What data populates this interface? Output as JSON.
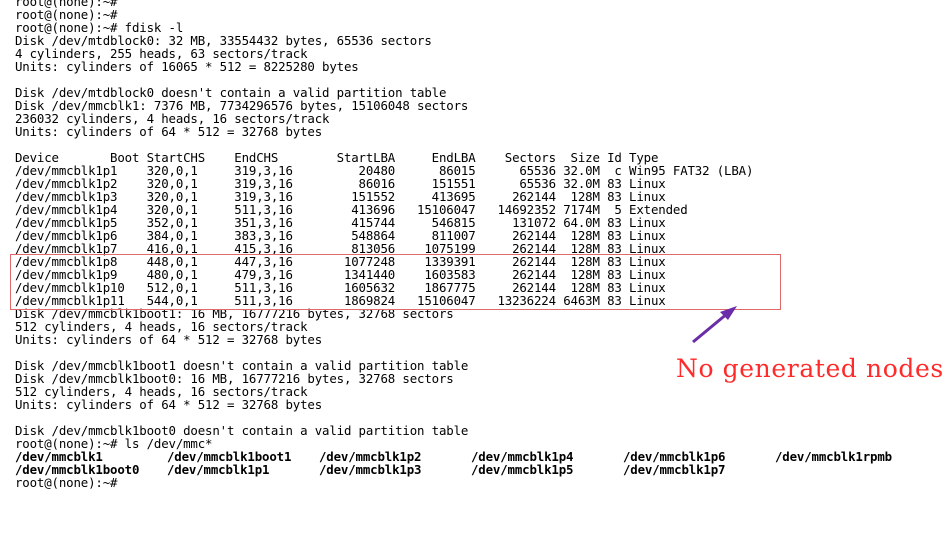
{
  "terminal": {
    "lines": [
      "root@(none):~#",
      "root@(none):~#",
      "root@(none):~# fdisk -l",
      "Disk /dev/mtdblock0: 32 MB, 33554432 bytes, 65536 sectors",
      "4 cylinders, 255 heads, 63 sectors/track",
      "Units: cylinders of 16065 * 512 = 8225280 bytes",
      "",
      "Disk /dev/mtdblock0 doesn't contain a valid partition table",
      "Disk /dev/mmcblk1: 7376 MB, 7734296576 bytes, 15106048 sectors",
      "236032 cylinders, 4 heads, 16 sectors/track",
      "Units: cylinders of 64 * 512 = 32768 bytes",
      "",
      "Device       Boot StartCHS    EndCHS        StartLBA     EndLBA    Sectors  Size Id Type",
      "/dev/mmcblk1p1    320,0,1     319,3,16         20480      86015      65536 32.0M  c Win95 FAT32 (LBA)",
      "/dev/mmcblk1p2    320,0,1     319,3,16         86016     151551      65536 32.0M 83 Linux",
      "/dev/mmcblk1p3    320,0,1     319,3,16        151552     413695     262144  128M 83 Linux",
      "/dev/mmcblk1p4    320,0,1     511,3,16        413696   15106047   14692352 7174M  5 Extended",
      "/dev/mmcblk1p5    352,0,1     351,3,16        415744     546815     131072 64.0M 83 Linux",
      "/dev/mmcblk1p6    384,0,1     383,3,16        548864     811007     262144  128M 83 Linux",
      "/dev/mmcblk1p7    416,0,1     415,3,16        813056    1075199     262144  128M 83 Linux",
      "/dev/mmcblk1p8    448,0,1     447,3,16       1077248    1339391     262144  128M 83 Linux",
      "/dev/mmcblk1p9    480,0,1     479,3,16       1341440    1603583     262144  128M 83 Linux",
      "/dev/mmcblk1p10   512,0,1     511,3,16       1605632    1867775     262144  128M 83 Linux",
      "/dev/mmcblk1p11   544,0,1     511,3,16       1869824   15106047   13236224 6463M 83 Linux",
      "Disk /dev/mmcblk1boot1: 16 MB, 16777216 bytes, 32768 sectors",
      "512 cylinders, 4 heads, 16 sectors/track",
      "Units: cylinders of 64 * 512 = 32768 bytes",
      "",
      "Disk /dev/mmcblk1boot1 doesn't contain a valid partition table",
      "Disk /dev/mmcblk1boot0: 16 MB, 16777216 bytes, 32768 sectors",
      "512 cylinders, 4 heads, 16 sectors/track",
      "Units: cylinders of 64 * 512 = 32768 bytes",
      "",
      "Disk /dev/mmcblk1boot0 doesn't contain a valid partition table",
      "root@(none):~# ls /dev/mmc*"
    ],
    "ls_output": [
      [
        "/dev/mmcblk1",
        "/dev/mmcblk1boot1",
        "/dev/mmcblk1p2",
        "/dev/mmcblk1p4",
        "/dev/mmcblk1p6",
        "/dev/mmcblk1rpmb"
      ],
      [
        "/dev/mmcblk1boot0",
        "/dev/mmcblk1p1",
        "/dev/mmcblk1p3",
        "/dev/mmcblk1p5",
        "/dev/mmcblk1p7"
      ]
    ],
    "final_prompt": "root@(none):~#"
  },
  "annotation": {
    "text": "No generated nodes",
    "color": "#ff2a2a",
    "arrow_color": "#6a2ca8",
    "box_color": "#e06a6a"
  }
}
